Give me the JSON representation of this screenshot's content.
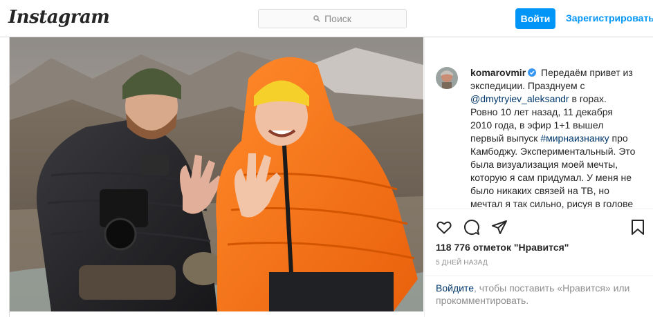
{
  "header": {
    "logo": "Instagram",
    "search_placeholder": "Поиск",
    "login_label": "Войти",
    "signup_label": "Зарегистрироваться"
  },
  "post": {
    "username": "komarovmir",
    "caption_parts": {
      "t1": " Передаём привет из экспедиции. Празднуем с ",
      "mention": "@dmytryiev_aleksandr",
      "t2": " в горах. Ровно 10 лет назад, 11 декабря 2010 года, в эфир 1+1 вышел первый выпуск ",
      "hashtag": "#мирнаизнанку",
      "t3": " про Камбоджу. Экспериментальный. Это была визуализация моей мечты, которую я сам придумал. У меня не было никаких связей на ТВ, но мечтал я так сильно, рисуя в голове"
    },
    "likes": "118 776 отметок \"Нравится\"",
    "time": "5 ДНЕЙ НАЗАД",
    "login_prompt": {
      "link": "Войдите",
      "rest": ", чтобы поставить «Нравится» или прокомментировать."
    }
  },
  "colors": {
    "accent": "#0095f6",
    "link": "#00376b",
    "muted": "#8e8e8e",
    "border": "#dbdbdb"
  },
  "icons": [
    "search-icon",
    "verified-badge-icon",
    "heart-icon",
    "comment-icon",
    "share-icon",
    "bookmark-icon"
  ]
}
